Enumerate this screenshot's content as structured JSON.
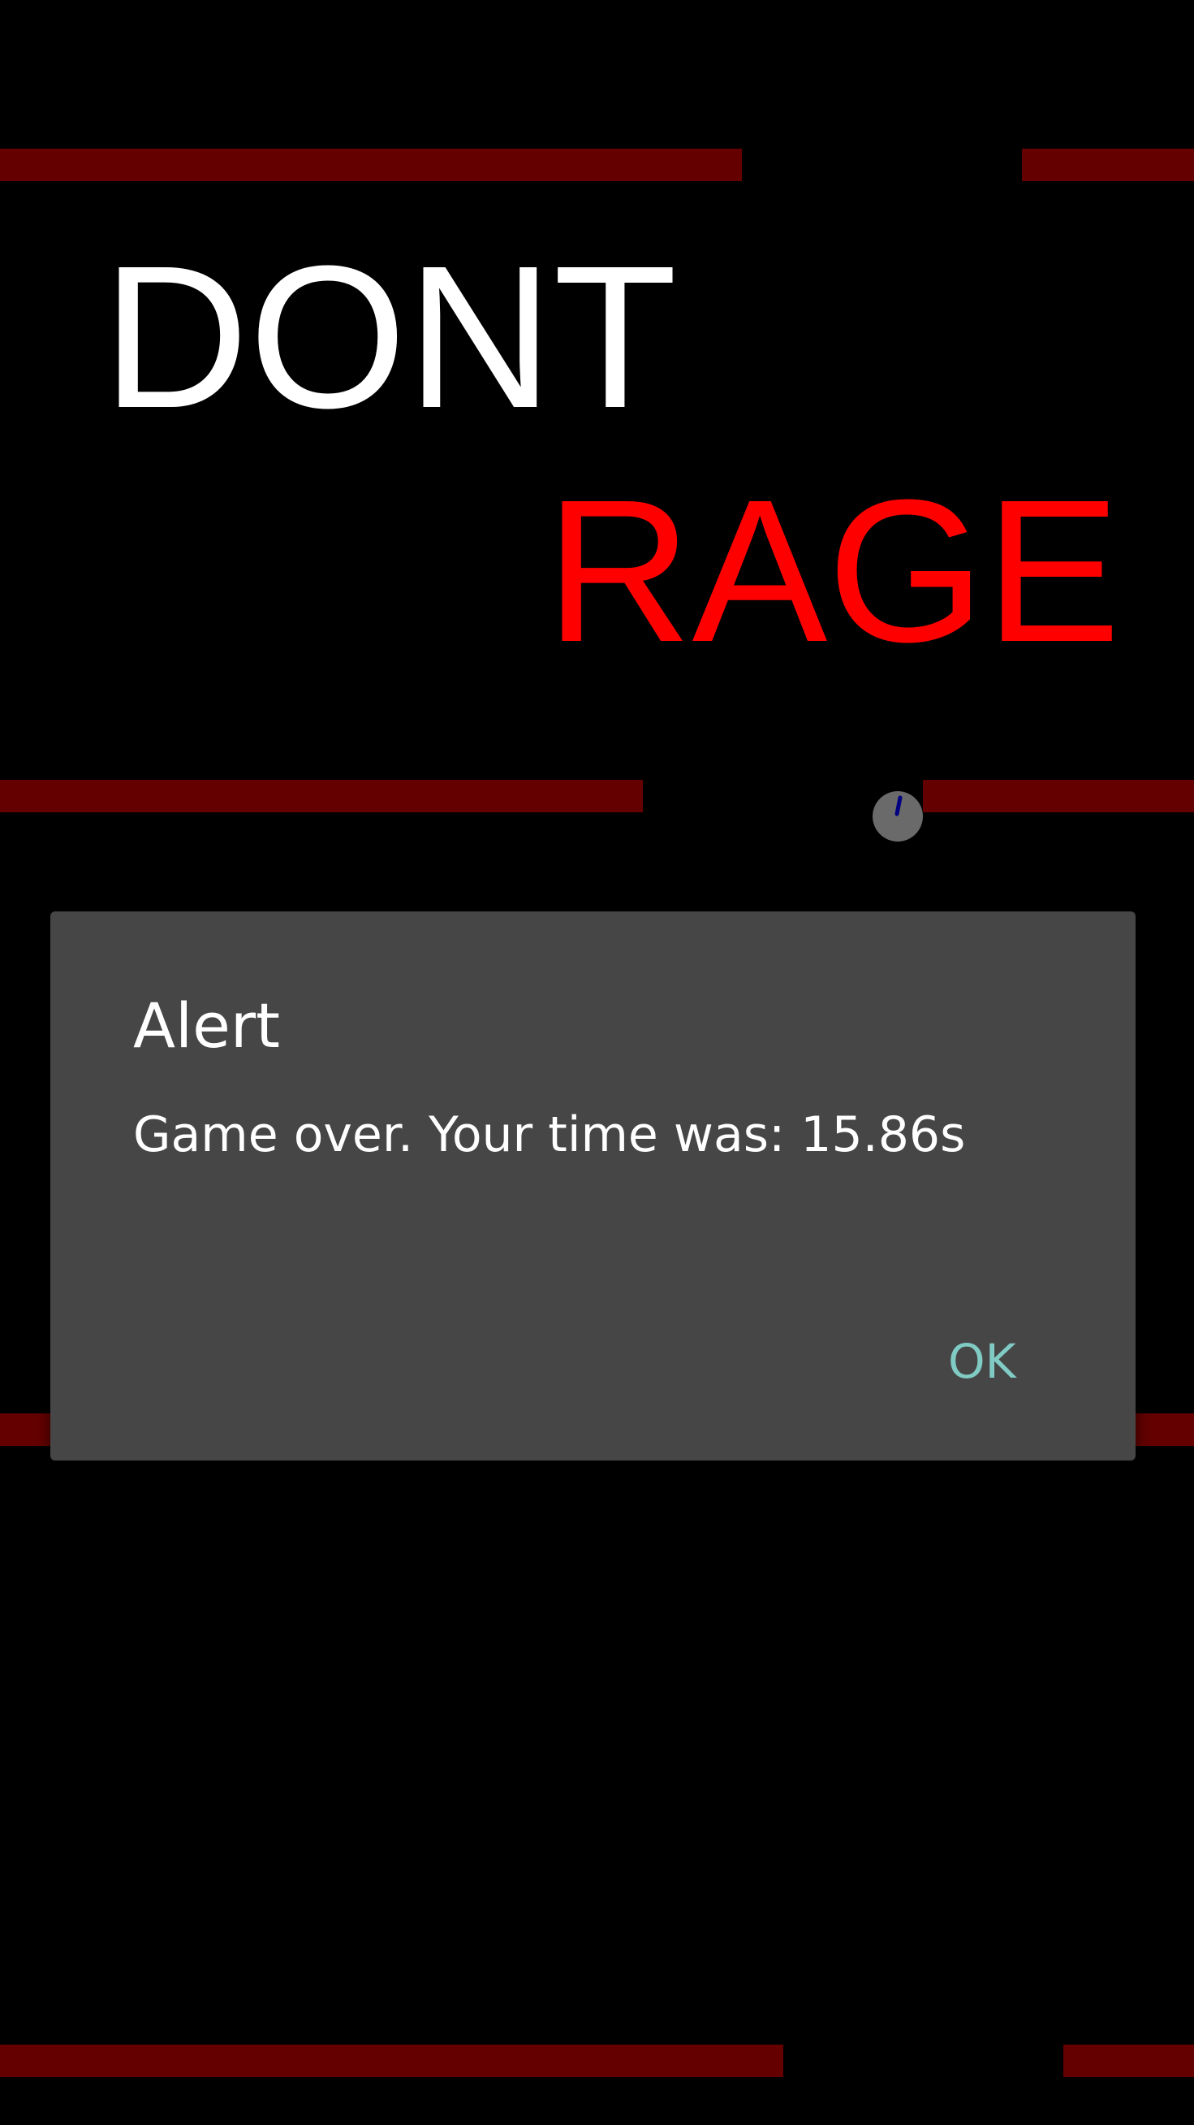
{
  "title": {
    "word1": "DONT",
    "word2": "RAGE"
  },
  "colors": {
    "background": "#000000",
    "obstacle_bar": "#640000",
    "word1": "#ffffff",
    "word2": "#ff0000",
    "ball": "#6a6a6a",
    "ball_marker": "#000080",
    "dialog_bg": "#464646",
    "dialog_button": "#80cbc4"
  },
  "dialog": {
    "title": "Alert",
    "message": "Game over. Your time was: 15.86s",
    "ok_label": "OK"
  }
}
